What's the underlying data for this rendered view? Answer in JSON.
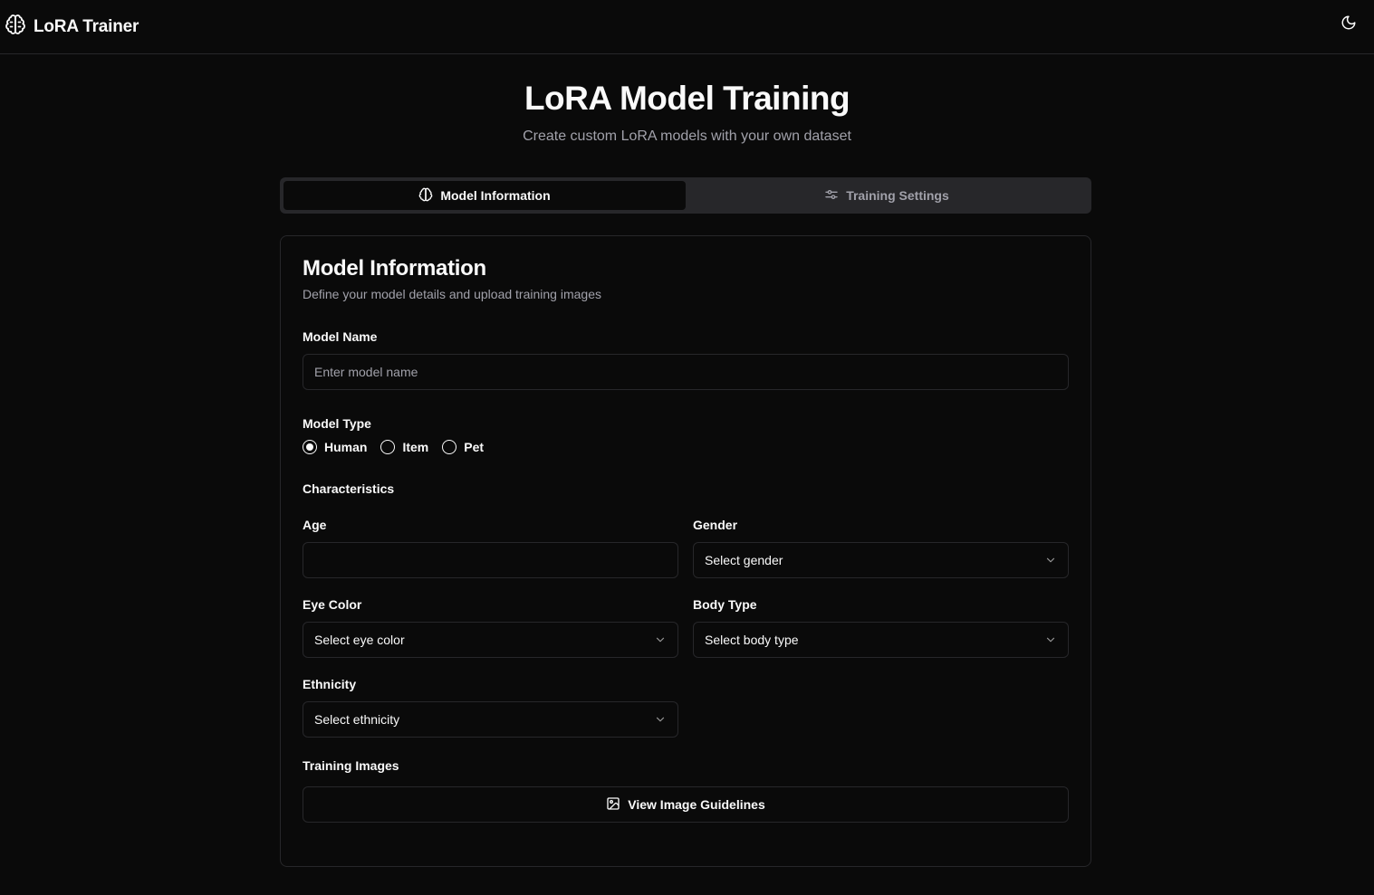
{
  "app": {
    "title": "LoRA Trainer"
  },
  "header": {
    "title": "LoRA Model Training",
    "subtitle": "Create custom LoRA models with your own dataset"
  },
  "tabs": [
    {
      "label": "Model Information",
      "active": true,
      "icon": "brain-icon"
    },
    {
      "label": "Training Settings",
      "active": false,
      "icon": "sliders-icon"
    }
  ],
  "card": {
    "title": "Model Information",
    "description": "Define your model details and upload training images"
  },
  "form": {
    "model_name": {
      "label": "Model Name",
      "placeholder": "Enter model name",
      "value": ""
    },
    "model_type": {
      "label": "Model Type",
      "options": [
        {
          "label": "Human",
          "selected": true
        },
        {
          "label": "Item",
          "selected": false
        },
        {
          "label": "Pet",
          "selected": false
        }
      ]
    },
    "characteristics_label": "Characteristics",
    "age": {
      "label": "Age",
      "value": ""
    },
    "gender": {
      "label": "Gender",
      "value": "Select gender"
    },
    "eye_color": {
      "label": "Eye Color",
      "value": "Select eye color"
    },
    "body_type": {
      "label": "Body Type",
      "value": "Select body type"
    },
    "ethnicity": {
      "label": "Ethnicity",
      "value": "Select ethnicity"
    },
    "training_images": {
      "label": "Training Images",
      "button_label": "View Image Guidelines"
    }
  },
  "colors": {
    "background": "#0a0a0a",
    "border": "#27272a",
    "muted": "#a1a1aa",
    "foreground": "#fafafa"
  }
}
